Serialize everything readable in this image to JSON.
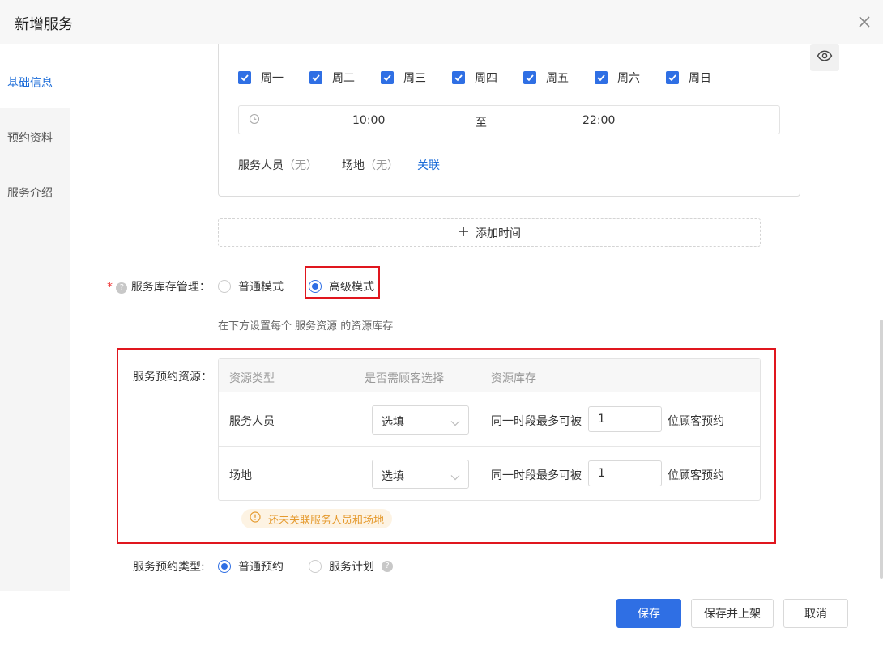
{
  "dialog": {
    "title": "新增服务"
  },
  "sidebar": {
    "items": [
      {
        "label": "基础信息",
        "active": true
      },
      {
        "label": "预约资料",
        "active": false
      },
      {
        "label": "服务介绍",
        "active": false
      }
    ]
  },
  "schedule": {
    "days": [
      {
        "label": "周一",
        "checked": true
      },
      {
        "label": "周二",
        "checked": true
      },
      {
        "label": "周三",
        "checked": true
      },
      {
        "label": "周四",
        "checked": true
      },
      {
        "label": "周五",
        "checked": true
      },
      {
        "label": "周六",
        "checked": true
      },
      {
        "label": "周日",
        "checked": true
      }
    ],
    "time_start": "10:00",
    "time_separator": "至",
    "time_end": "22:00",
    "staff_label": "服务人员",
    "staff_value": "（无）",
    "venue_label": "场地",
    "venue_value": "（无）",
    "link_label": "关联",
    "add_time_label": "添加时间"
  },
  "inventory": {
    "required_mark": "*",
    "label": "服务库存管理：",
    "options": [
      {
        "label": "普通模式",
        "selected": false
      },
      {
        "label": "高级模式",
        "selected": true
      }
    ],
    "hint": "在下方设置每个 服务资源 的资源库存"
  },
  "resources": {
    "label": "服务预约资源：",
    "headers": [
      "资源类型",
      "是否需顾客选择",
      "资源库存"
    ],
    "rows": [
      {
        "type": "服务人员",
        "select_value": "选填",
        "stock_prefix": "同一时段最多可被",
        "stock_value": "1",
        "stock_suffix": "位顾客预约"
      },
      {
        "type": "场地",
        "select_value": "选填",
        "stock_prefix": "同一时段最多可被",
        "stock_value": "1",
        "stock_suffix": "位顾客预约"
      }
    ],
    "warning": "还未关联服务人员和场地"
  },
  "booking_type": {
    "label": "服务预约类型:",
    "options": [
      {
        "label": "普通预约",
        "selected": true
      },
      {
        "label": "服务计划",
        "selected": false
      }
    ]
  },
  "footer": {
    "save_label": "保存",
    "save_publish_label": "保存并上架",
    "cancel_label": "取消"
  },
  "colors": {
    "accent": "#2f6fe4",
    "highlight_border": "#e0161e",
    "warning_text": "#e59a2e",
    "warning_bg": "#fdf3e3"
  },
  "icons": {
    "close": "close-icon",
    "eye": "eye-icon",
    "clock": "clock-icon",
    "plus": "plus-icon",
    "help": "help-icon",
    "chevron": "chevron-down-icon",
    "warning": "warning-icon",
    "check": "check-icon"
  }
}
